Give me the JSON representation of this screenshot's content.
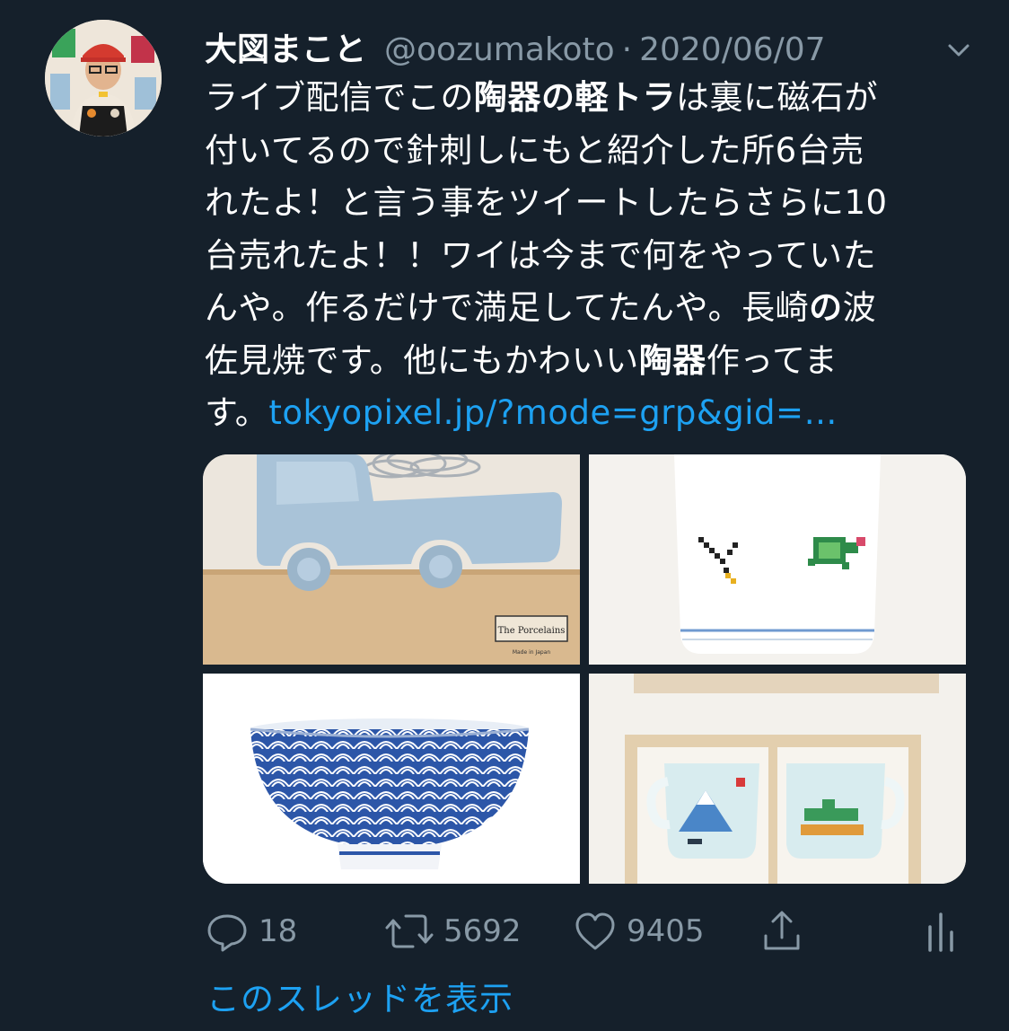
{
  "tweet": {
    "display_name": "大図まこと",
    "handle": "@oozumakoto",
    "separator": "·",
    "date": "2020/06/07",
    "body": {
      "l1a": "ライブ配信でこの",
      "l1b": "陶器の軽トラ",
      "l1c": "は裏に磁石が",
      "l2": "付いてるので針刺しにもと紹介した所6台売",
      "l3": "れたよ！と言う事をツイートしたらさらに10",
      "l4": "台売れたよ！！ワイは今まで何をやっていた",
      "l5a": "んや。作るだけで満足してたんや。長崎",
      "l5b": "の",
      "l5c": "波",
      "l6a": "佐見焼です。他にもかわいい",
      "l6b": "陶器",
      "l6c": "作ってま",
      "l7a": "す。",
      "link": "tokyopixel.jp/?mode=grp&gid=…"
    },
    "media": {
      "label1": "The Porcelains",
      "label2": "Made in Japan"
    },
    "actions": {
      "replies": "18",
      "retweets": "5692",
      "likes": "9405"
    },
    "show_thread": "このスレッドを表示"
  },
  "colors": {
    "background": "#15202b",
    "text": "#ffffff",
    "secondary": "#8899a6",
    "link": "#1da1f2"
  },
  "icons": [
    "chevron-down-icon",
    "reply-icon",
    "retweet-icon",
    "like-icon",
    "share-icon",
    "analytics-icon"
  ]
}
